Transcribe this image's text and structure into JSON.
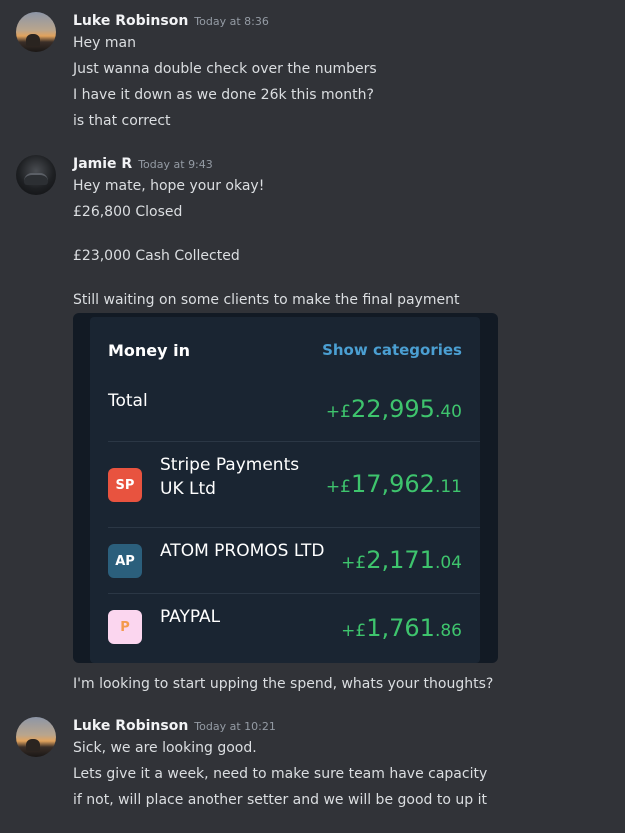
{
  "messages": [
    {
      "author": "Luke Robinson",
      "time": "Today at 8:36",
      "lines": [
        "Hey man",
        "Just wanna double check over the numbers",
        "I have it down as we done 26k this month?",
        "is that correct"
      ]
    },
    {
      "author": "Jamie R",
      "time": "Today at 9:43",
      "lines": [
        "Hey mate, hope your okay!",
        "£26,800 Closed",
        "£23,000 Cash Collected",
        "Still waiting on some clients to make the final payment"
      ],
      "after_embed": "I'm looking to start upping the spend, whats your thoughts?"
    },
    {
      "author": "Luke Robinson",
      "time": "Today at 10:21",
      "lines": [
        "Sick, we are looking good.",
        "Lets give it a week, need to make sure team have capacity",
        "if not, will place another setter and we will be good to up it"
      ]
    }
  ],
  "embed": {
    "title": "Money in",
    "link": "Show categories",
    "total_label": "Total",
    "total_prefix": "+£",
    "total_major": "22,995",
    "total_minor": ".40",
    "rows": [
      {
        "initials": "SP",
        "name_line1": "Stripe Payments",
        "name_line2": "UK Ltd",
        "prefix": "+£",
        "major": "17,962",
        "minor": ".11"
      },
      {
        "initials": "AP",
        "name_line1": "ATOM PROMOS LTD",
        "prefix": "+£",
        "major": "2,171",
        "minor": ".04"
      },
      {
        "initials": "P",
        "name_line1": "PAYPAL",
        "prefix": "+£",
        "major": "1,761",
        "minor": ".86"
      }
    ]
  },
  "colors": {
    "background": "#313338",
    "amount_green": "#3ec46d",
    "link_blue": "#4b9fd2"
  }
}
